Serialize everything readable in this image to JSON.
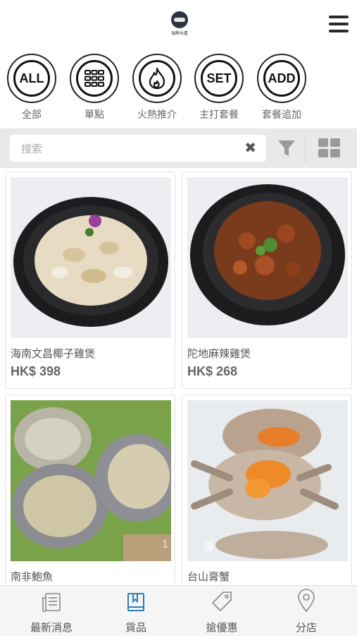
{
  "header": {
    "logo_text": "瑞鮮水產",
    "menu_icon": "hamburger-menu-icon"
  },
  "categories": [
    {
      "badge": "ALL",
      "label": "全部"
    },
    {
      "badge": "grid",
      "label": "單點"
    },
    {
      "badge": "flame",
      "label": "火熱推介"
    },
    {
      "badge": "SET",
      "label": "主打套餐"
    },
    {
      "badge": "ADD",
      "label": "套餐追加"
    }
  ],
  "search": {
    "placeholder": "搜索",
    "value": ""
  },
  "products": [
    {
      "name": "海南文昌椰子雞煲",
      "price": "HK$ 398",
      "image": "coconut-chicken-pot"
    },
    {
      "name": "陀地麻辣雞煲",
      "price": "HK$ 268",
      "image": "spicy-chicken-pot"
    },
    {
      "name": "南非鮑魚",
      "price": "",
      "image": "abalone"
    },
    {
      "name": "台山膏蟹",
      "price": "",
      "image": "crab"
    }
  ],
  "image_overlay_text": {
    "abalone": "1",
    "crab": "優"
  },
  "tabbar": [
    {
      "label": "最新消息",
      "icon": "news-icon"
    },
    {
      "label": "貨品",
      "icon": "book-icon",
      "active": true
    },
    {
      "label": "搶優惠",
      "icon": "tag-icon"
    },
    {
      "label": "分店",
      "icon": "location-pin-icon"
    }
  ],
  "colors": {
    "active_tab": "#2f7bb7",
    "search_bar_bg": "#e9e9ea"
  }
}
